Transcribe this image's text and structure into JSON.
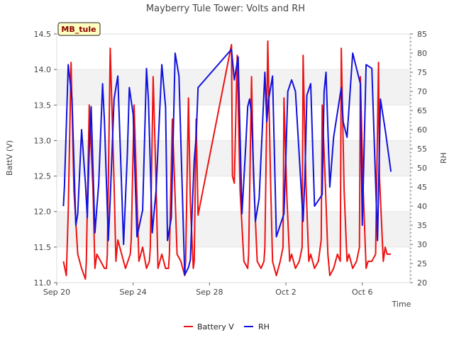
{
  "chart_data": {
    "type": "line",
    "title": "Mayberry Tule Tower: Volts and RH",
    "badge": "MB_tule",
    "xlabel": "Time",
    "ylabel_left": "BattV (V)",
    "ylabel_right": "RH",
    "x_ticks": [
      {
        "day": 0,
        "label": "Sep 20"
      },
      {
        "day": 4,
        "label": "Sep 24"
      },
      {
        "day": 8,
        "label": "Sep 28"
      },
      {
        "day": 12,
        "label": "Oct 2"
      },
      {
        "day": 16,
        "label": "Oct 6"
      }
    ],
    "x_range_days": [
      0,
      18.5
    ],
    "y_left": {
      "range": [
        11.0,
        14.5
      ],
      "ticks": [
        "11.0",
        "11.5",
        "12.0",
        "12.5",
        "13.0",
        "13.5",
        "14.0",
        "14.5"
      ]
    },
    "y_right": {
      "range": [
        20,
        85
      ],
      "ticks": [
        "20",
        "25",
        "30",
        "35",
        "40",
        "45",
        "50",
        "55",
        "60",
        "65",
        "70",
        "75",
        "80",
        "85"
      ]
    },
    "grid": "alternating horizontal bands",
    "legend_position": "bottom-center",
    "series": [
      {
        "name": "Battery V",
        "axis": "left",
        "color": "#ee1111",
        "x": [
          0.35,
          0.5,
          0.6,
          0.75,
          0.9,
          1.1,
          1.3,
          1.5,
          1.55,
          1.7,
          1.9,
          2.0,
          2.1,
          2.3,
          2.5,
          2.6,
          2.65,
          2.8,
          3.0,
          3.1,
          3.2,
          3.4,
          3.6,
          3.85,
          3.9,
          4.05,
          4.2,
          4.3,
          4.5,
          4.7,
          4.85,
          4.9,
          5.05,
          5.2,
          5.3,
          5.5,
          5.7,
          5.85,
          5.9,
          6.05,
          6.2,
          6.3,
          6.5,
          6.7,
          6.75,
          6.9,
          7.0,
          7.1,
          7.15,
          7.2,
          7.3,
          7.4,
          9.15,
          9.2,
          9.3,
          9.45,
          9.6,
          9.8,
          10.0,
          10.05,
          10.2,
          10.3,
          10.5,
          10.7,
          10.85,
          10.9,
          11.05,
          11.2,
          11.3,
          11.5,
          11.7,
          11.85,
          11.9,
          12.05,
          12.2,
          12.3,
          12.5,
          12.7,
          12.85,
          12.9,
          13.05,
          13.2,
          13.3,
          13.5,
          13.7,
          13.85,
          13.9,
          14.05,
          14.2,
          14.3,
          14.5,
          14.7,
          14.85,
          14.9,
          15.05,
          15.2,
          15.3,
          15.5,
          15.7,
          15.85,
          15.9,
          16.05,
          16.2,
          16.3,
          16.5,
          16.7,
          16.85,
          16.9,
          17.1,
          17.2,
          17.3,
          17.5
        ],
        "values": [
          11.3,
          11.1,
          12.0,
          14.1,
          12.3,
          11.4,
          11.2,
          11.05,
          11.3,
          13.5,
          12.3,
          11.2,
          11.4,
          11.3,
          11.2,
          11.2,
          11.4,
          14.3,
          12.4,
          11.3,
          11.6,
          11.4,
          11.2,
          11.4,
          11.6,
          13.5,
          12.2,
          11.3,
          11.5,
          11.2,
          11.3,
          11.5,
          13.9,
          12.4,
          11.2,
          11.4,
          11.2,
          11.2,
          11.4,
          13.3,
          12.2,
          11.4,
          11.3,
          11.1,
          11.3,
          13.6,
          12.1,
          11.5,
          11.2,
          11.3,
          13.3,
          11.95,
          14.35,
          12.5,
          12.4,
          14.2,
          12.3,
          11.3,
          11.2,
          11.4,
          13.9,
          12.5,
          11.3,
          11.2,
          11.3,
          11.5,
          14.4,
          12.4,
          11.3,
          11.1,
          11.3,
          11.5,
          13.6,
          12.2,
          11.3,
          11.4,
          11.2,
          11.3,
          11.5,
          14.2,
          12.4,
          11.3,
          11.4,
          11.2,
          11.3,
          11.6,
          13.5,
          12.5,
          11.4,
          11.1,
          11.2,
          11.4,
          11.3,
          14.3,
          12.3,
          11.3,
          11.4,
          11.2,
          11.3,
          11.5,
          13.9,
          12.3,
          11.2,
          11.3,
          11.3,
          11.4,
          14.1,
          12.5,
          11.3,
          11.5,
          11.4,
          11.4
        ]
      },
      {
        "name": "RH",
        "axis": "right",
        "color": "#1111dd",
        "x": [
          0.35,
          0.4,
          0.6,
          0.8,
          1.0,
          1.1,
          1.3,
          1.5,
          1.6,
          1.7,
          1.8,
          2.0,
          2.2,
          2.4,
          2.5,
          2.7,
          2.8,
          3.0,
          3.2,
          3.5,
          3.7,
          3.8,
          4.0,
          4.2,
          4.5,
          4.7,
          4.8,
          5.0,
          5.2,
          5.5,
          5.7,
          5.8,
          6.0,
          6.2,
          6.4,
          6.7,
          6.9,
          7.0,
          7.1,
          7.2,
          7.3,
          7.4,
          9.15,
          9.3,
          9.5,
          9.7,
          9.9,
          10.0,
          10.1,
          10.2,
          10.4,
          10.6,
          10.9,
          11.0,
          11.1,
          11.3,
          11.5,
          11.9,
          12.0,
          12.1,
          12.3,
          12.5,
          12.9,
          13.0,
          13.1,
          13.3,
          13.5,
          13.9,
          14.0,
          14.1,
          14.3,
          14.5,
          14.9,
          15.0,
          15.2,
          15.5,
          15.9,
          16.0,
          16.2,
          16.5,
          16.8,
          16.95,
          17.2,
          17.5
        ],
        "values": [
          40,
          45,
          77,
          68,
          35,
          38,
          60,
          46,
          37,
          55,
          66,
          33,
          46,
          72,
          62,
          31,
          42,
          68,
          74,
          30,
          54,
          71,
          64,
          32,
          39,
          76,
          68,
          33,
          44,
          77,
          66,
          31,
          37,
          80,
          74,
          22,
          24,
          26,
          40,
          52,
          58,
          71,
          81,
          73,
          79,
          38,
          56,
          66,
          68,
          64,
          36,
          42,
          75,
          62,
          68,
          74,
          32,
          38,
          53,
          70,
          73,
          70,
          36,
          48,
          69,
          72,
          40,
          43,
          70,
          75,
          45,
          58,
          71,
          62,
          58,
          80,
          72,
          35,
          77,
          76,
          31,
          68,
          60,
          49
        ]
      }
    ]
  },
  "legend": {
    "battery_label": "Battery V",
    "rh_label": "RH"
  }
}
